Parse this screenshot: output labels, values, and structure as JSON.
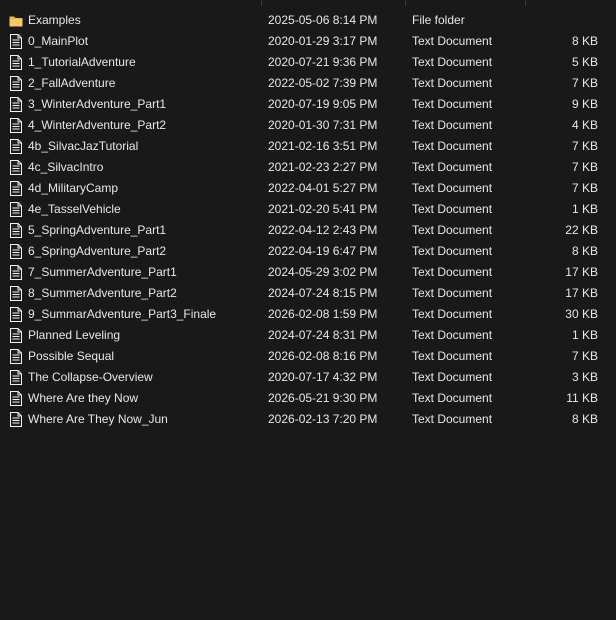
{
  "files": [
    {
      "name": "Examples",
      "date": "2025-05-06 8:14 PM",
      "type": "File folder",
      "size": "",
      "icon": "folder-icon"
    },
    {
      "name": "0_MainPlot",
      "date": "2020-01-29 3:17 PM",
      "type": "Text Document",
      "size": "8 KB",
      "icon": "text-file-icon"
    },
    {
      "name": "1_TutorialAdventure",
      "date": "2020-07-21 9:36 PM",
      "type": "Text Document",
      "size": "5 KB",
      "icon": "text-file-icon"
    },
    {
      "name": "2_FallAdventure",
      "date": "2022-05-02 7:39 PM",
      "type": "Text Document",
      "size": "7 KB",
      "icon": "text-file-icon"
    },
    {
      "name": "3_WinterAdventure_Part1",
      "date": "2020-07-19 9:05 PM",
      "type": "Text Document",
      "size": "9 KB",
      "icon": "text-file-icon"
    },
    {
      "name": "4_WinterAdventure_Part2",
      "date": "2020-01-30 7:31 PM",
      "type": "Text Document",
      "size": "4 KB",
      "icon": "text-file-icon"
    },
    {
      "name": "4b_SilvacJazTutorial",
      "date": "2021-02-16 3:51 PM",
      "type": "Text Document",
      "size": "7 KB",
      "icon": "text-file-icon"
    },
    {
      "name": "4c_SilvacIntro",
      "date": "2021-02-23 2:27 PM",
      "type": "Text Document",
      "size": "7 KB",
      "icon": "text-file-icon"
    },
    {
      "name": "4d_MilitaryCamp",
      "date": "2022-04-01 5:27 PM",
      "type": "Text Document",
      "size": "7 KB",
      "icon": "text-file-icon"
    },
    {
      "name": "4e_TasselVehicle",
      "date": "2021-02-20 5:41 PM",
      "type": "Text Document",
      "size": "1 KB",
      "icon": "text-file-icon"
    },
    {
      "name": "5_SpringAdventure_Part1",
      "date": "2022-04-12 2:43 PM",
      "type": "Text Document",
      "size": "22 KB",
      "icon": "text-file-icon"
    },
    {
      "name": "6_SpringAdventure_Part2",
      "date": "2022-04-19 6:47 PM",
      "type": "Text Document",
      "size": "8 KB",
      "icon": "text-file-icon"
    },
    {
      "name": "7_SummerAdventure_Part1",
      "date": "2024-05-29 3:02 PM",
      "type": "Text Document",
      "size": "17 KB",
      "icon": "text-file-icon"
    },
    {
      "name": "8_SummerAdventure_Part2",
      "date": "2024-07-24 8:15 PM",
      "type": "Text Document",
      "size": "17 KB",
      "icon": "text-file-icon"
    },
    {
      "name": "9_SummarAdventure_Part3_Finale",
      "date": "2026-02-08 1:59 PM",
      "type": "Text Document",
      "size": "30 KB",
      "icon": "text-file-icon"
    },
    {
      "name": "Planned Leveling",
      "date": "2024-07-24 8:31 PM",
      "type": "Text Document",
      "size": "1 KB",
      "icon": "text-file-icon"
    },
    {
      "name": "Possible Sequal",
      "date": "2026-02-08 8:16 PM",
      "type": "Text Document",
      "size": "7 KB",
      "icon": "text-file-icon"
    },
    {
      "name": "The Collapse-Overview",
      "date": "2020-07-17 4:32 PM",
      "type": "Text Document",
      "size": "3 KB",
      "icon": "text-file-icon"
    },
    {
      "name": "Where Are they Now",
      "date": "2026-05-21 9:30 PM",
      "type": "Text Document",
      "size": "11 KB",
      "icon": "text-file-icon"
    },
    {
      "name": "Where Are They Now_Jun",
      "date": "2026-02-13 7:20 PM",
      "type": "Text Document",
      "size": "8 KB",
      "icon": "text-file-icon"
    }
  ],
  "colors": {
    "background": "#191919",
    "text": "#e8e8e8",
    "folder": "#e8b84a",
    "file_icon": "#f2f2f2"
  }
}
